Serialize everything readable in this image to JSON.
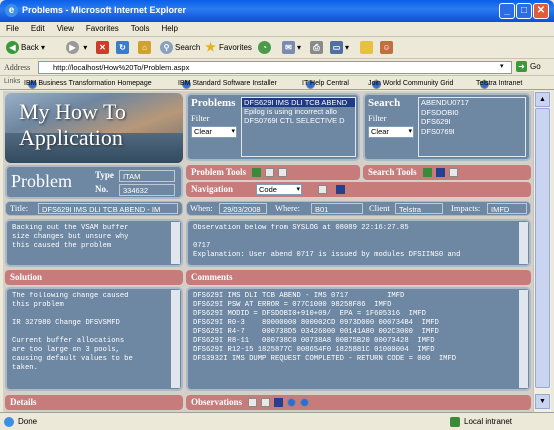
{
  "window": {
    "title": "Problems - Microsoft Internet Explorer"
  },
  "menu": [
    "File",
    "Edit",
    "View",
    "Favorites",
    "Tools",
    "Help"
  ],
  "toolbar": {
    "back": "Back",
    "search": "Search",
    "favorites": "Favorites"
  },
  "address": {
    "label": "Address",
    "url": "http://localhost/How%20To/Problem.aspx",
    "go": "Go"
  },
  "links": {
    "label": "Links",
    "items": [
      "IBM Business Transformation Homepage",
      "IBM Standard Software Installer",
      "IT Help Central",
      "Join World Community Grid",
      "Telstra Intranet"
    ]
  },
  "app": {
    "banner_line1": "My How To",
    "banner_line2": "Application"
  },
  "problems": {
    "title": "Problems",
    "filter_label": "Filter",
    "filter_value": "Clear",
    "list": [
      "DFS629I IMS DLI TCB ABEND",
      "Epilog is using incorrect allo",
      "DFS0769I CTL SELECTIVE D"
    ]
  },
  "search": {
    "title": "Search",
    "filter_label": "Filter",
    "filter_value": "Clear",
    "list": [
      "ABENDU0717",
      "DFSDOBI0",
      "DFS629I",
      "DFS0769I"
    ]
  },
  "problem": {
    "heading": "Problem",
    "type_label": "Type",
    "type_value": "ITAM",
    "no_label": "No.",
    "no_value": "334632"
  },
  "bars": {
    "problem_tools": "Problem Tools",
    "search_tools": "Search Tools",
    "navigation": "Navigation",
    "nav_value": "Code",
    "solution": "Solution",
    "comments": "Comments",
    "details": "Details",
    "observations": "Observations"
  },
  "fields": {
    "title_label": "Title:",
    "title_value": "DFS629I IMS DLI TCB ABEND - IM",
    "when_label": "When:",
    "when_value": "29/03/2008",
    "where_label": "Where:",
    "where_value": "B01",
    "client_label": "Client",
    "client_value": "Telstra",
    "impacts_label": "Impacts:",
    "impacts_value": "IMFD"
  },
  "description": "Backing out the VSAM buffer\nsize changes but unsure why\nthis caused the problem",
  "observation": "Observation below from SYSLOG at 08089 22:16:27.85\n\n0717\nExplanation: User abend 0717 is issued by modules DFSIINS0 and",
  "solution_text": "The following change caused\nthis problem\n\nIR 327980 Change DFSVSMFD\n\nCurrent buffer allocations\nare too large on 3 pools,\ncausing default values to be\ntaken.",
  "comments_text": "DFS629I IMS DLI TCB ABEND - IMS 0717         IMFD\nDFS629I PSW AT ERROR = 077C1000 98258F86  IMFD\nDFS629I MODID = DFSDOBI0+910+09/  EPA = 1F605316  IMFD\nDFS629I R0-3    80000000 800002CD 0973D000 000734B4  IMFD\nDFS629I R4-7    000738D5 03426000 00141A80 002C3000  IMFD\nDFS629I R8-11   000738C0 00738A8 00B75B20 00073428  IMFD\nDFS629I R12-15 1825877C 008654F0 1825881C 01000004  IMFD\nDFS3932I IMS DUMP REQUEST COMPLETED - RETURN CODE = 000  IMFD",
  "status": {
    "left": "Done",
    "right": "Local intranet"
  }
}
